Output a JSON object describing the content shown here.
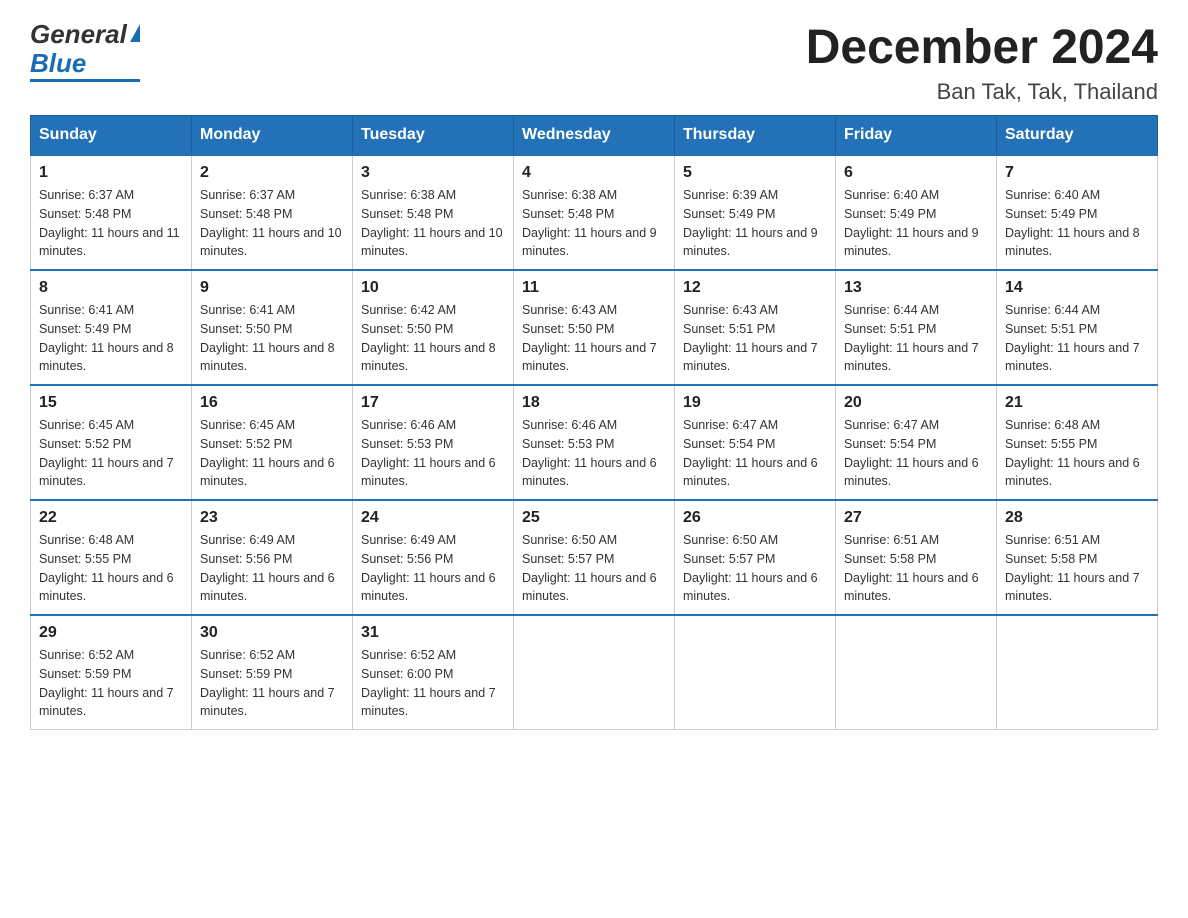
{
  "header": {
    "month_year": "December 2024",
    "location": "Ban Tak, Tak, Thailand",
    "logo_general": "General",
    "logo_blue": "Blue"
  },
  "weekdays": [
    "Sunday",
    "Monday",
    "Tuesday",
    "Wednesday",
    "Thursday",
    "Friday",
    "Saturday"
  ],
  "weeks": [
    [
      {
        "day": "1",
        "sunrise": "6:37 AM",
        "sunset": "5:48 PM",
        "daylight": "11 hours and 11 minutes."
      },
      {
        "day": "2",
        "sunrise": "6:37 AM",
        "sunset": "5:48 PM",
        "daylight": "11 hours and 10 minutes."
      },
      {
        "day": "3",
        "sunrise": "6:38 AM",
        "sunset": "5:48 PM",
        "daylight": "11 hours and 10 minutes."
      },
      {
        "day": "4",
        "sunrise": "6:38 AM",
        "sunset": "5:48 PM",
        "daylight": "11 hours and 9 minutes."
      },
      {
        "day": "5",
        "sunrise": "6:39 AM",
        "sunset": "5:49 PM",
        "daylight": "11 hours and 9 minutes."
      },
      {
        "day": "6",
        "sunrise": "6:40 AM",
        "sunset": "5:49 PM",
        "daylight": "11 hours and 9 minutes."
      },
      {
        "day": "7",
        "sunrise": "6:40 AM",
        "sunset": "5:49 PM",
        "daylight": "11 hours and 8 minutes."
      }
    ],
    [
      {
        "day": "8",
        "sunrise": "6:41 AM",
        "sunset": "5:49 PM",
        "daylight": "11 hours and 8 minutes."
      },
      {
        "day": "9",
        "sunrise": "6:41 AM",
        "sunset": "5:50 PM",
        "daylight": "11 hours and 8 minutes."
      },
      {
        "day": "10",
        "sunrise": "6:42 AM",
        "sunset": "5:50 PM",
        "daylight": "11 hours and 8 minutes."
      },
      {
        "day": "11",
        "sunrise": "6:43 AM",
        "sunset": "5:50 PM",
        "daylight": "11 hours and 7 minutes."
      },
      {
        "day": "12",
        "sunrise": "6:43 AM",
        "sunset": "5:51 PM",
        "daylight": "11 hours and 7 minutes."
      },
      {
        "day": "13",
        "sunrise": "6:44 AM",
        "sunset": "5:51 PM",
        "daylight": "11 hours and 7 minutes."
      },
      {
        "day": "14",
        "sunrise": "6:44 AM",
        "sunset": "5:51 PM",
        "daylight": "11 hours and 7 minutes."
      }
    ],
    [
      {
        "day": "15",
        "sunrise": "6:45 AM",
        "sunset": "5:52 PM",
        "daylight": "11 hours and 7 minutes."
      },
      {
        "day": "16",
        "sunrise": "6:45 AM",
        "sunset": "5:52 PM",
        "daylight": "11 hours and 6 minutes."
      },
      {
        "day": "17",
        "sunrise": "6:46 AM",
        "sunset": "5:53 PM",
        "daylight": "11 hours and 6 minutes."
      },
      {
        "day": "18",
        "sunrise": "6:46 AM",
        "sunset": "5:53 PM",
        "daylight": "11 hours and 6 minutes."
      },
      {
        "day": "19",
        "sunrise": "6:47 AM",
        "sunset": "5:54 PM",
        "daylight": "11 hours and 6 minutes."
      },
      {
        "day": "20",
        "sunrise": "6:47 AM",
        "sunset": "5:54 PM",
        "daylight": "11 hours and 6 minutes."
      },
      {
        "day": "21",
        "sunrise": "6:48 AM",
        "sunset": "5:55 PM",
        "daylight": "11 hours and 6 minutes."
      }
    ],
    [
      {
        "day": "22",
        "sunrise": "6:48 AM",
        "sunset": "5:55 PM",
        "daylight": "11 hours and 6 minutes."
      },
      {
        "day": "23",
        "sunrise": "6:49 AM",
        "sunset": "5:56 PM",
        "daylight": "11 hours and 6 minutes."
      },
      {
        "day": "24",
        "sunrise": "6:49 AM",
        "sunset": "5:56 PM",
        "daylight": "11 hours and 6 minutes."
      },
      {
        "day": "25",
        "sunrise": "6:50 AM",
        "sunset": "5:57 PM",
        "daylight": "11 hours and 6 minutes."
      },
      {
        "day": "26",
        "sunrise": "6:50 AM",
        "sunset": "5:57 PM",
        "daylight": "11 hours and 6 minutes."
      },
      {
        "day": "27",
        "sunrise": "6:51 AM",
        "sunset": "5:58 PM",
        "daylight": "11 hours and 6 minutes."
      },
      {
        "day": "28",
        "sunrise": "6:51 AM",
        "sunset": "5:58 PM",
        "daylight": "11 hours and 7 minutes."
      }
    ],
    [
      {
        "day": "29",
        "sunrise": "6:52 AM",
        "sunset": "5:59 PM",
        "daylight": "11 hours and 7 minutes."
      },
      {
        "day": "30",
        "sunrise": "6:52 AM",
        "sunset": "5:59 PM",
        "daylight": "11 hours and 7 minutes."
      },
      {
        "day": "31",
        "sunrise": "6:52 AM",
        "sunset": "6:00 PM",
        "daylight": "11 hours and 7 minutes."
      },
      null,
      null,
      null,
      null
    ]
  ]
}
